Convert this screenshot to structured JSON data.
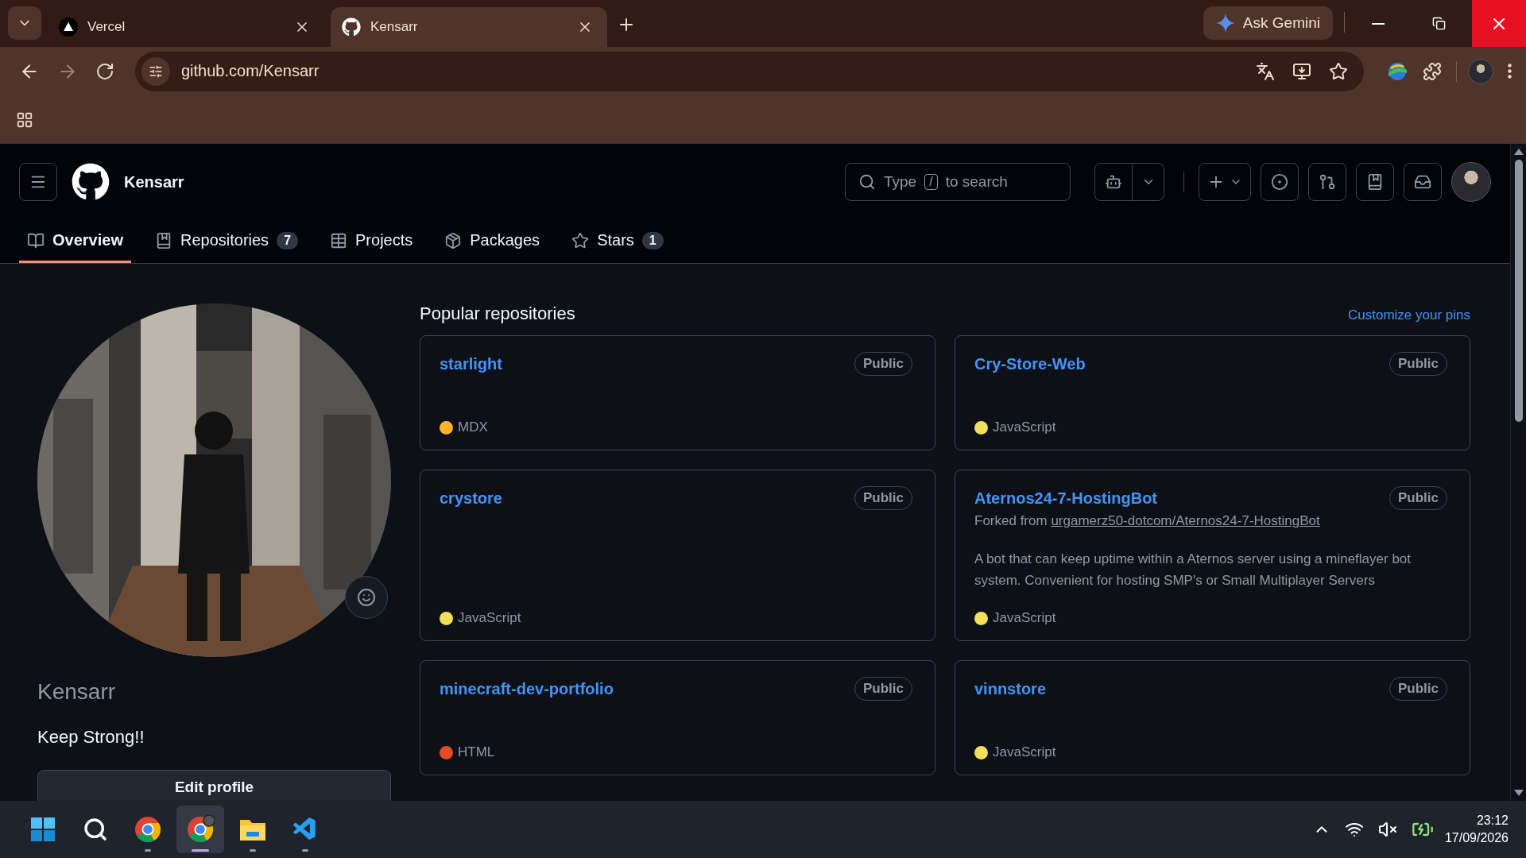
{
  "browser": {
    "tabs": [
      {
        "title": "Vercel",
        "kind": "triangle",
        "selected": false
      },
      {
        "title": "Kensarr",
        "kind": "github",
        "selected": true
      }
    ],
    "gemini": "Ask Gemini",
    "url": "github.com/Kensarr"
  },
  "header": {
    "username": "Kensarr",
    "search": {
      "prefix": "Type",
      "key": "/",
      "suffix": "to search"
    }
  },
  "nav": [
    {
      "label": "Overview",
      "kind": "book",
      "selected": true
    },
    {
      "label": "Repositories",
      "kind": "repo",
      "count": "7",
      "selected": false
    },
    {
      "label": "Projects",
      "kind": "table",
      "selected": false
    },
    {
      "label": "Packages",
      "kind": "package",
      "selected": false
    },
    {
      "label": "Stars",
      "kind": "star",
      "count": "1",
      "selected": false
    }
  ],
  "profile": {
    "name": "Kensarr",
    "bio": "Keep Strong!!",
    "edit_button": "Edit profile"
  },
  "pinned": {
    "title": "Popular repositories",
    "customize_link": "Customize your pins",
    "repos": [
      {
        "name": "starlight",
        "visibility": "Public",
        "language": "MDX",
        "color": "#fcb32c"
      },
      {
        "name": "Cry-Store-Web",
        "visibility": "Public",
        "language": "JavaScript",
        "color": "#f1e05a"
      },
      {
        "name": "crystore",
        "visibility": "Public",
        "language": "JavaScript",
        "color": "#f1e05a"
      },
      {
        "name": "Aternos24-7-HostingBot",
        "visibility": "Public",
        "forked_prefix": "Forked from",
        "forked_from": "urgamerz50-dotcom/Aternos24-7-HostingBot",
        "description": "A bot that can keep uptime within a Aternos server using a mineflayer bot system. Convenient for hosting SMP's or Small Multiplayer Servers",
        "language": "JavaScript",
        "color": "#f1e05a"
      },
      {
        "name": "minecraft-dev-portfolio",
        "visibility": "Public",
        "language": "HTML",
        "color": "#e34c26"
      },
      {
        "name": "vinnstore",
        "visibility": "Public",
        "language": "JavaScript",
        "color": "#f1e05a"
      }
    ]
  },
  "taskbar": {
    "apps": [
      {
        "kind": "start",
        "running": false,
        "selected": false
      },
      {
        "kind": "search",
        "running": false,
        "selected": false
      },
      {
        "kind": "chrome",
        "running": true,
        "selected": false
      },
      {
        "kind": "chrome-profile",
        "running": true,
        "selected": true
      },
      {
        "kind": "files",
        "running": true,
        "selected": false
      },
      {
        "kind": "vscode",
        "running": true,
        "selected": false
      }
    ],
    "time": "23:12",
    "date": "17/09/2026"
  }
}
